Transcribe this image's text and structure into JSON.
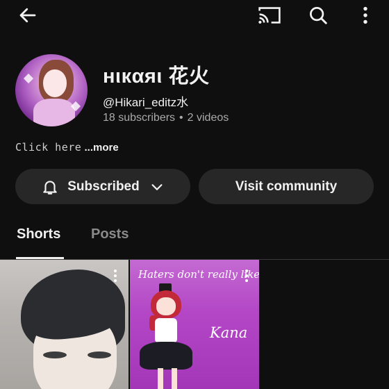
{
  "topbar": {
    "back_icon": "arrow-left-icon",
    "cast_icon": "cast-icon",
    "search_icon": "search-icon",
    "more_icon": "more-vertical-icon"
  },
  "channel": {
    "name": "нιкαяι 花火",
    "handle": "@Hikari_editz水",
    "subscribers": "18 subscribers",
    "separator": "•",
    "videos": "2 videos",
    "description_preview": "Click here",
    "more_label": "...more"
  },
  "actions": {
    "subscribed_label": "Subscribed",
    "subscribed_icon": "bell-icon",
    "subscribed_menu_icon": "chevron-down-icon",
    "community_label": "Visit community"
  },
  "tabs": [
    {
      "label": "Shorts",
      "active": true
    },
    {
      "label": "Posts",
      "active": false
    }
  ],
  "shorts": [
    {
      "caption": ""
    },
    {
      "caption": "Haters don't really like",
      "overlay_text": "Kana"
    }
  ],
  "colors": {
    "background": "#0f0f0f",
    "button_bg": "#272727",
    "text_primary": "#f1f1f1",
    "text_secondary": "#aaaaaa",
    "short2_bg": "#b347c6"
  }
}
